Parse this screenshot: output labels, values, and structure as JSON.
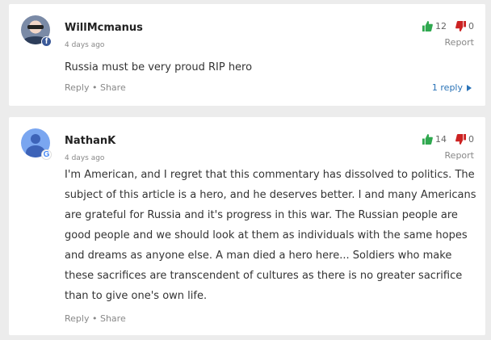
{
  "colors": {
    "upvote": "#2fa84f",
    "downvote": "#cc2222",
    "link": "#2a73b7"
  },
  "comments": [
    {
      "author": "WillMcmanus",
      "time": "4 days ago",
      "source_badge": "f",
      "text": "Russia must be very proud RIP hero",
      "upvotes": "12",
      "downvotes": "0",
      "report": "Report",
      "reply": "Reply",
      "sep": "•",
      "share": "Share",
      "replies": "1 reply"
    },
    {
      "author": "NathanK",
      "time": "4 days ago",
      "source_badge": "G",
      "text": "I'm American, and I regret that this commentary has dissolved to politics. The subject of this article is a hero, and he deserves better. I and many Americans are grateful for Russia and it's progress in this war. The Russian people are good people and we should look at them as individuals with the same hopes and dreams as anyone else. A man died a hero here... Soldiers who make these sacrifices are transcendent of cultures as there is no greater sacrifice than to give one's own life.",
      "upvotes": "14",
      "downvotes": "0",
      "report": "Report",
      "reply": "Reply",
      "sep": "•",
      "share": "Share"
    }
  ],
  "icons": [
    "thumbs-up-icon",
    "thumbs-down-icon",
    "facebook-badge-icon",
    "google-badge-icon",
    "triangle-right-icon"
  ]
}
